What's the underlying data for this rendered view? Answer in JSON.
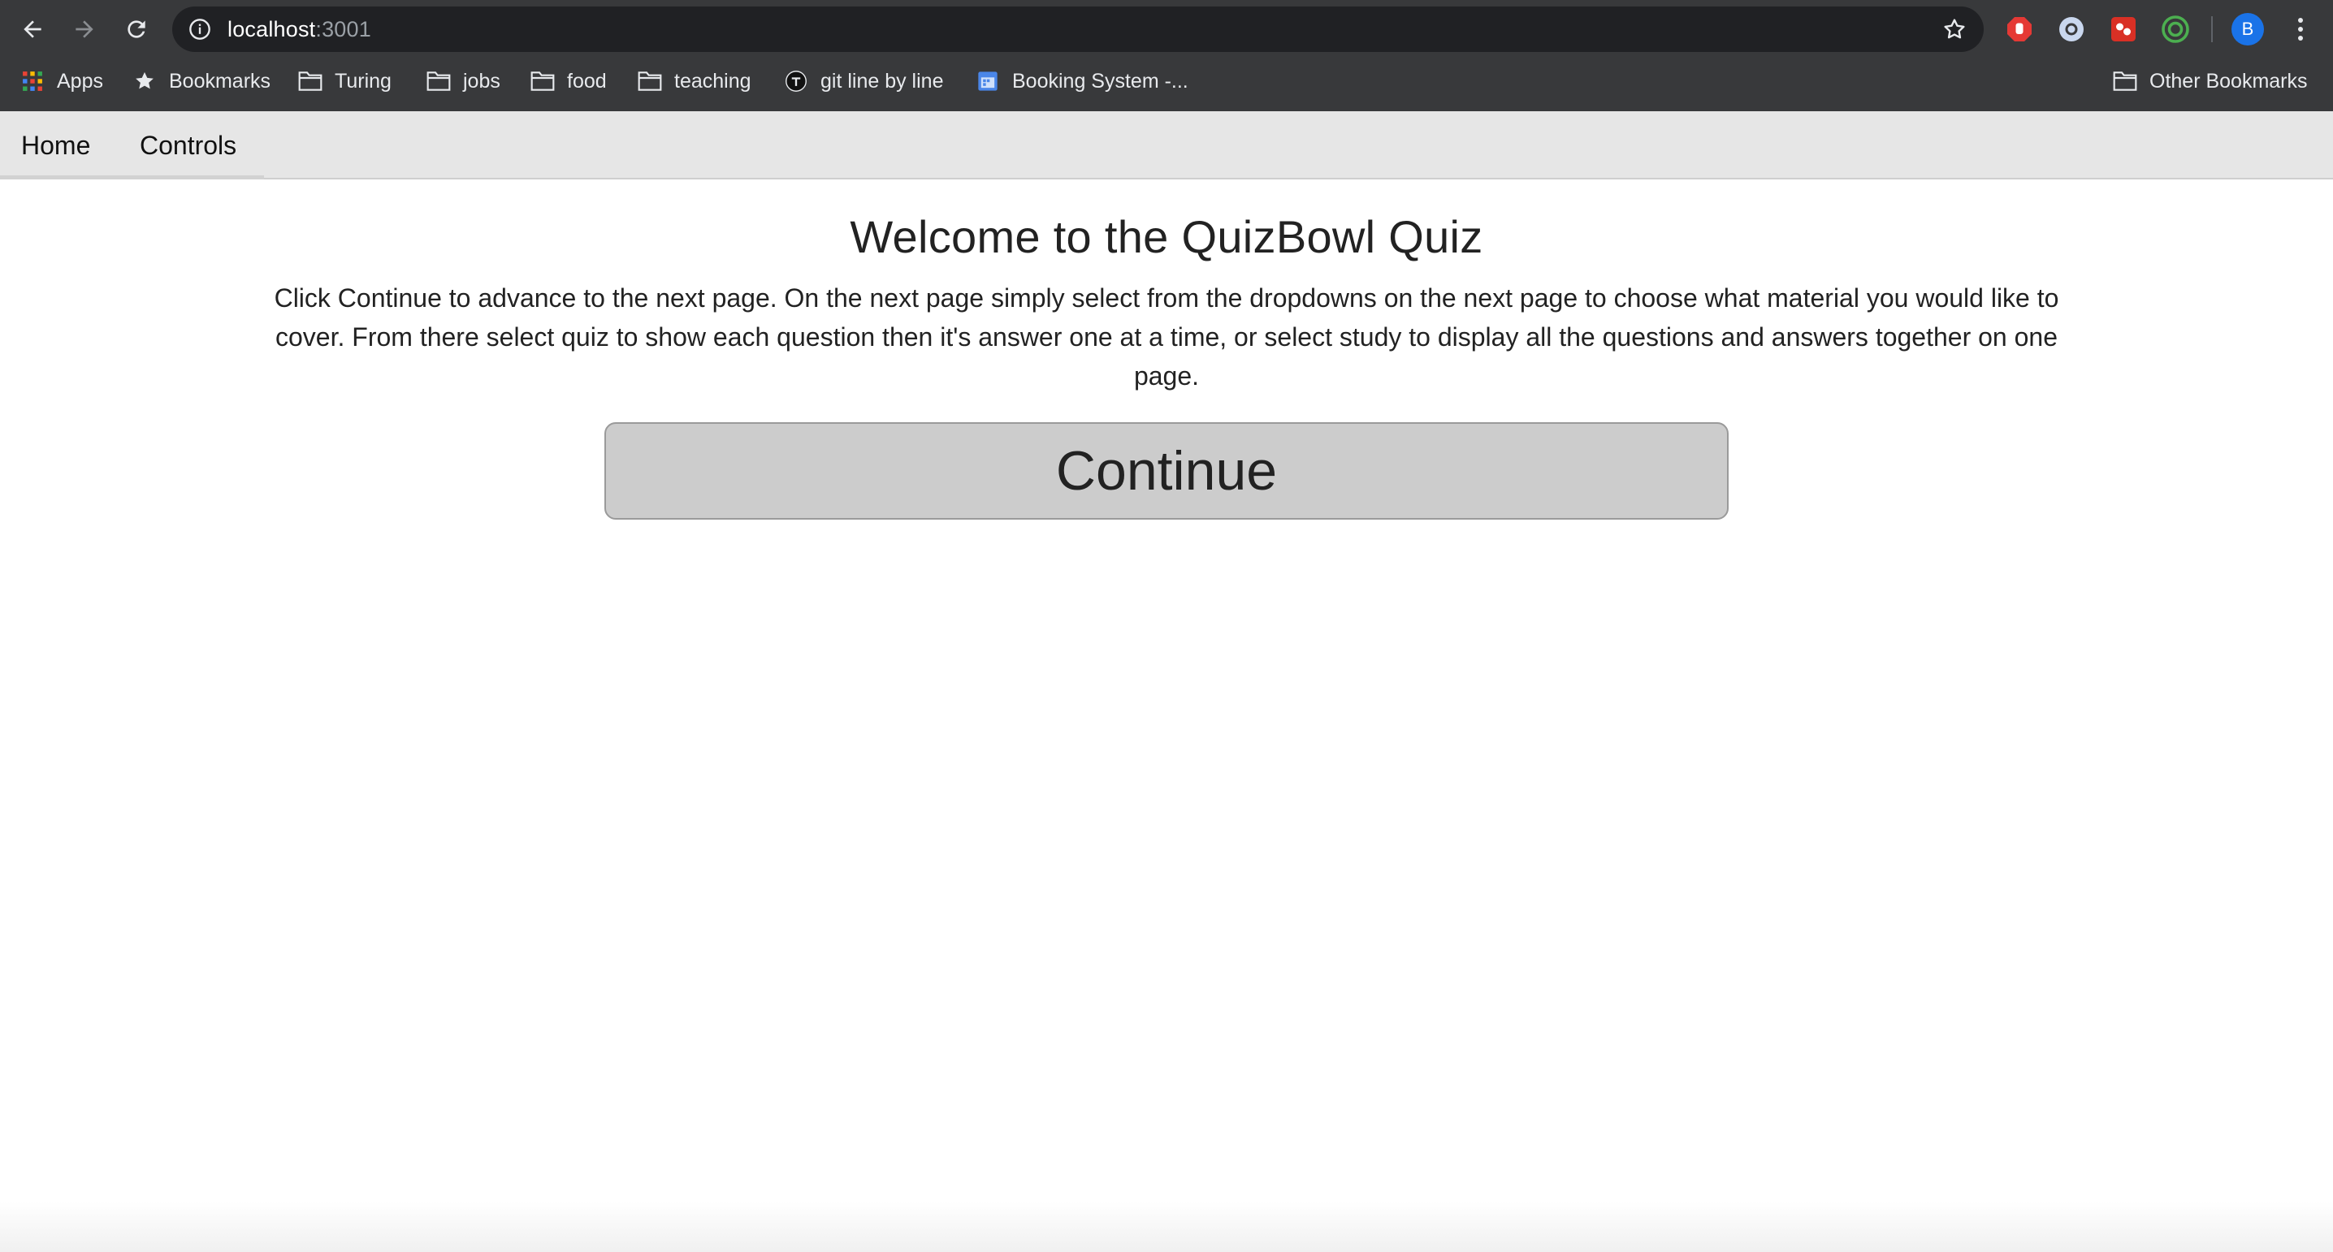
{
  "browser": {
    "url_host": "localhost",
    "url_port": ":3001",
    "profile_initial": "B",
    "icons": {
      "back": "back-arrow-icon",
      "forward": "forward-arrow-icon",
      "reload": "reload-icon",
      "info": "info-icon",
      "star": "star-icon",
      "menu": "kebab-menu-icon"
    }
  },
  "bookmarks_bar": {
    "items": [
      {
        "label": "Apps",
        "icon": "apps-grid-icon"
      },
      {
        "label": "Bookmarks",
        "icon": "star-icon"
      },
      {
        "label": "Turing",
        "icon": "folder-icon"
      },
      {
        "label": "jobs",
        "icon": "folder-icon"
      },
      {
        "label": "food",
        "icon": "folder-icon"
      },
      {
        "label": "teaching",
        "icon": "folder-icon"
      },
      {
        "label": "git line by line",
        "icon": "site-favicon-icon"
      },
      {
        "label": "Booking System -...",
        "icon": "calendar-icon"
      }
    ],
    "other": {
      "label": "Other Bookmarks",
      "icon": "folder-icon"
    }
  },
  "nav": {
    "items": [
      {
        "label": "Home"
      },
      {
        "label": "Controls"
      }
    ]
  },
  "main": {
    "title": "Welcome to the QuizBowl Quiz",
    "description": "Click Continue to advance to the next page. On the next page simply select from the dropdowns on the next page to choose what material you would like to cover. From there select quiz to show each question then it's answer one at a time, or select study to display all the questions and answers together on one page.",
    "continue_label": "Continue"
  },
  "colors": {
    "chrome_bg": "#38393b",
    "omnibox_bg": "#202124",
    "nav_bg": "#e6e6e6",
    "button_bg": "#cccccc",
    "text": "#222222"
  }
}
